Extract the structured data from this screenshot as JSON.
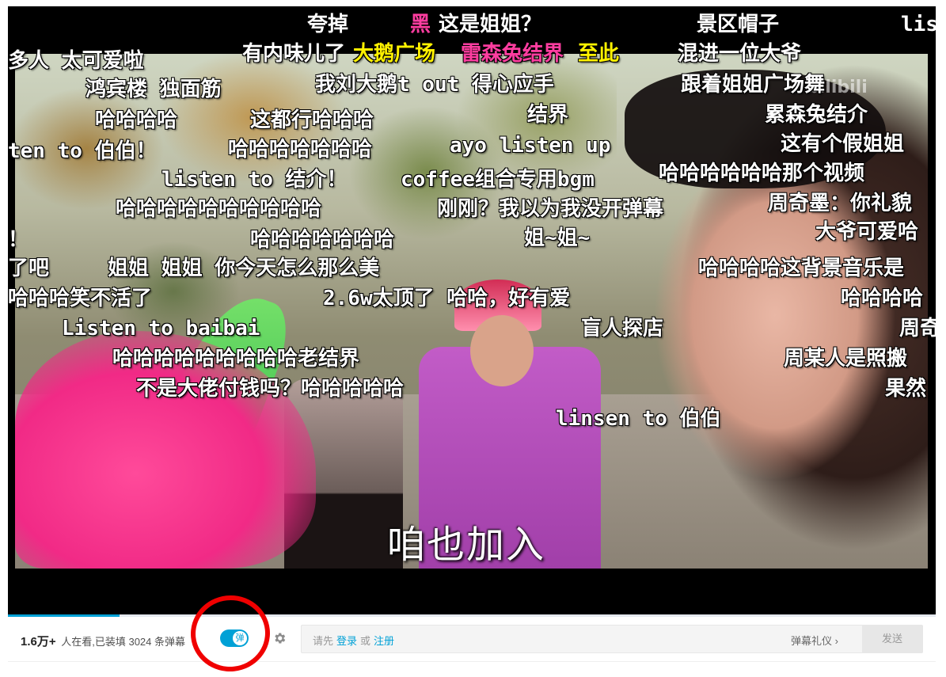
{
  "video": {
    "subtitle": "咱也加入",
    "watermark": "bilibili"
  },
  "danmaku": [
    {
      "text": "夸掉",
      "color": "#ffffff"
    },
    {
      "text": "黑",
      "color": "#ff3da0"
    },
    {
      "text": "这是姐姐？",
      "color": "#ffffff"
    },
    {
      "text": "景区帽子",
      "color": "#ffffff"
    },
    {
      "text": "lis",
      "color": "#ffffff"
    },
    {
      "text": "多人 太可爱啦",
      "color": "#ffffff"
    },
    {
      "text": "有内味儿了",
      "color": "#ffffff"
    },
    {
      "text": "大鹅广场",
      "color": "#fff200"
    },
    {
      "text": "雷森兔结界",
      "color": "#ff3da0"
    },
    {
      "text": "至此",
      "color": "#fff200"
    },
    {
      "text": "混进一位大爷",
      "color": "#ffffff"
    },
    {
      "text": "鸿宾楼 独面筋",
      "color": "#ffffff"
    },
    {
      "text": "我刘大鹅t out 得心应手",
      "color": "#ffffff"
    },
    {
      "text": "跟着姐姐广场舞",
      "color": "#ffffff"
    },
    {
      "text": "哈哈哈哈",
      "color": "#ffffff"
    },
    {
      "text": "这都行哈哈哈",
      "color": "#ffffff"
    },
    {
      "text": "结界",
      "color": "#ffffff"
    },
    {
      "text": "累森兔结介",
      "color": "#ffffff"
    },
    {
      "text": "ten to 伯伯！",
      "color": "#ffffff"
    },
    {
      "text": "哈哈哈哈哈哈哈",
      "color": "#ffffff"
    },
    {
      "text": "ayo listen up",
      "color": "#ffffff"
    },
    {
      "text": "这有个假姐姐",
      "color": "#ffffff"
    },
    {
      "text": "listen to 结介！",
      "color": "#ffffff"
    },
    {
      "text": "coffee组合专用bgm",
      "color": "#ffffff"
    },
    {
      "text": "哈哈哈哈哈哈那个视频",
      "color": "#ffffff"
    },
    {
      "text": "哈哈哈哈哈哈哈哈哈哈",
      "color": "#ffffff"
    },
    {
      "text": "刚刚？我以为我没开弹幕",
      "color": "#ffffff"
    },
    {
      "text": "周奇墨：你礼貌",
      "color": "#ffffff"
    },
    {
      "text": "！",
      "color": "#ffffff"
    },
    {
      "text": "哈哈哈哈哈哈哈",
      "color": "#ffffff"
    },
    {
      "text": "姐~姐~",
      "color": "#ffffff"
    },
    {
      "text": "大爷可爱哈",
      "color": "#ffffff"
    },
    {
      "text": "了吧",
      "color": "#ffffff"
    },
    {
      "text": "姐姐 姐姐 你今天怎么那么美",
      "color": "#ffffff"
    },
    {
      "text": "哈哈哈哈这背景音乐是",
      "color": "#ffffff"
    },
    {
      "text": "哈哈哈笑不活了",
      "color": "#ffffff"
    },
    {
      "text": "2.6w太顶了 哈哈，好有爱",
      "color": "#ffffff"
    },
    {
      "text": "哈哈哈哈",
      "color": "#ffffff"
    },
    {
      "text": "Listen to baibai",
      "color": "#ffffff"
    },
    {
      "text": "盲人探店",
      "color": "#ffffff"
    },
    {
      "text": "周奇",
      "color": "#ffffff"
    },
    {
      "text": "哈哈哈哈哈哈哈哈哈老结界",
      "color": "#ffffff"
    },
    {
      "text": "周某人是照搬",
      "color": "#ffffff"
    },
    {
      "text": "不是大佬付钱吗？哈哈哈哈哈",
      "color": "#ffffff"
    },
    {
      "text": "果然",
      "color": "#ffffff"
    },
    {
      "text": "linsen to 伯伯",
      "color": "#ffffff"
    }
  ],
  "controls": {
    "viewer_count": "1.6万+",
    "viewer_text": "人在看,已装填 3024 条弹幕",
    "danmaku_toggle_label": "弹",
    "danmaku_toggle_on": true,
    "settings_icon": "gear-icon",
    "input_prefix": "请先",
    "login_link": "登录",
    "or_text": "或",
    "register_link": "注册",
    "etiquette_label": "弹幕礼仪 ›",
    "send_label": "发送",
    "progress": 0.12,
    "accent_color": "#00a1d6"
  },
  "annotation": {
    "shape": "red-circle",
    "color": "#f00000"
  }
}
